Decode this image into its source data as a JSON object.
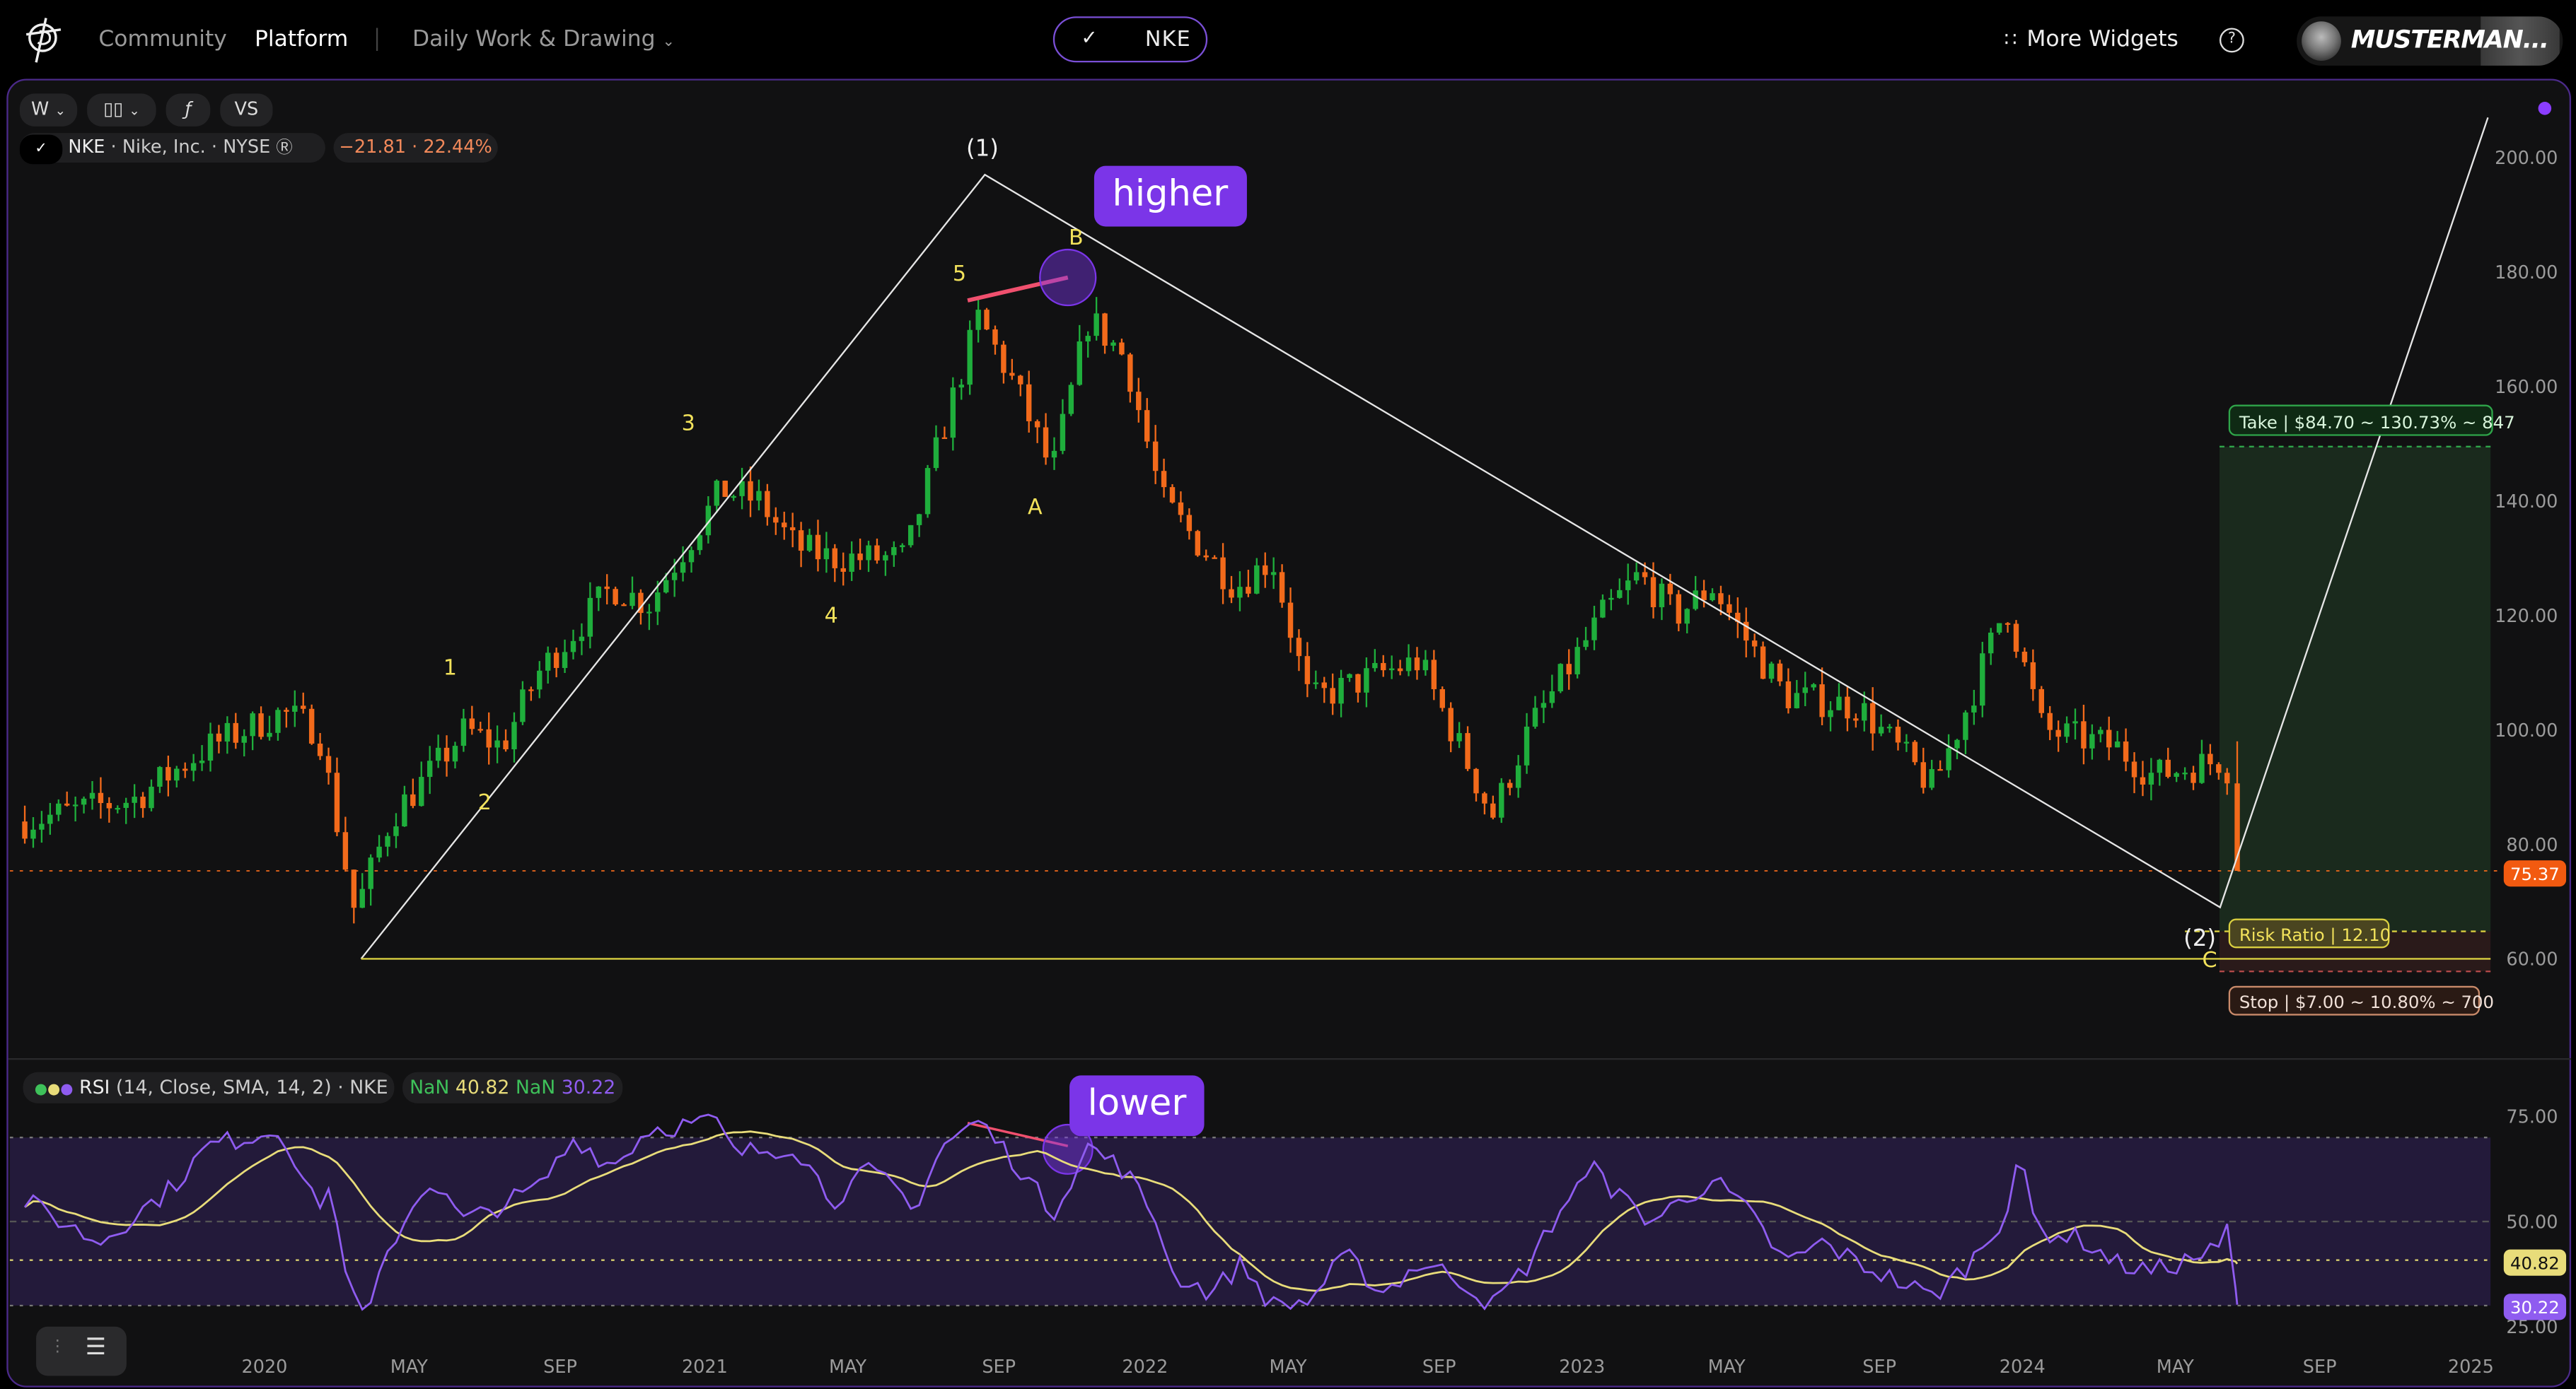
{
  "header": {
    "nav": [
      "Community",
      "Platform"
    ],
    "workspace": "Daily Work & Drawing",
    "ticker": "NKE",
    "more_widgets": "More Widgets",
    "help": "?",
    "user_name": "MUSTERMAN..."
  },
  "toolbar": {
    "interval": "W",
    "chart_type_icon": "candles-icon",
    "indicators_icon": "function-icon",
    "compare": "VS"
  },
  "legend": {
    "symbol": "NKE",
    "name": "Nike, Inc.",
    "exchange": "NYSE",
    "change": "−21.81 · 22.44%"
  },
  "annotations": {
    "higher": "higher",
    "lower": "lower",
    "waves": {
      "w1": "1",
      "w2": "2",
      "w3": "3",
      "w4": "4",
      "w5": "5",
      "wA": "A",
      "wB": "B",
      "wC": "C",
      "p1": "(1)",
      "p2": "(2)"
    },
    "take": "Take | $84.70 ~ 130.73% ~ 847",
    "risk": "Risk Ratio | 12.10",
    "stop": "Stop | $7.00 ~ 10.80% ~ 700"
  },
  "rsi_legend": {
    "title": "RSI",
    "params": "(14, Close, SMA, 14, 2)",
    "symbol": "NKE",
    "v1": "NaN",
    "v2": "40.82",
    "v3": "NaN",
    "v4": "30.22"
  },
  "colors": {
    "up": "#1fae3c",
    "down": "#f26a1b",
    "accent": "#7b35e8",
    "rsi": "#8f5cf0",
    "sma": "#e8dc7a",
    "wave_labels": "#f2e25b"
  },
  "chart_data": [
    {
      "type": "candlestick",
      "symbol": "NKE",
      "interval": "W",
      "last_price": 75.37,
      "ylim": [
        55,
        210
      ],
      "yticks": [
        "200.00",
        "180.00",
        "160.00",
        "140.00",
        "120.00",
        "100.00",
        "80.00",
        "60.00"
      ],
      "xticks": [
        "2020",
        "MAY",
        "SEP",
        "2021",
        "MAY",
        "SEP",
        "2022",
        "MAY",
        "SEP",
        "2023",
        "MAY",
        "SEP",
        "2024",
        "MAY",
        "SEP",
        "2025"
      ],
      "last_price_label": "75.37",
      "approx_close_path": [
        [
          "2019-06",
          84
        ],
        [
          "2019-09",
          88
        ],
        [
          "2019-11",
          97
        ],
        [
          "2020-01",
          103
        ],
        [
          "2020-02",
          100
        ],
        [
          "2020-03",
          68
        ],
        [
          "2020-04",
          85
        ],
        [
          "2020-05",
          92
        ],
        [
          "2020-06",
          100
        ],
        [
          "2020-07",
          97
        ],
        [
          "2020-08",
          110
        ],
        [
          "2020-10",
          125
        ],
        [
          "2020-11",
          122
        ],
        [
          "2021-01",
          142
        ],
        [
          "2021-02",
          140
        ],
        [
          "2021-03",
          132
        ],
        [
          "2021-04",
          130
        ],
        [
          "2021-06",
          130
        ],
        [
          "2021-07",
          152
        ],
        [
          "2021-08",
          172
        ],
        [
          "2021-09",
          160
        ],
        [
          "2021-10",
          145
        ],
        [
          "2021-11",
          172
        ],
        [
          "2021-12",
          165
        ],
        [
          "2022-01",
          140
        ],
        [
          "2022-03",
          125
        ],
        [
          "2022-04",
          130
        ],
        [
          "2022-05",
          105
        ],
        [
          "2022-07",
          110
        ],
        [
          "2022-08",
          112
        ],
        [
          "2022-10",
          85
        ],
        [
          "2022-11",
          100
        ],
        [
          "2023-01",
          120
        ],
        [
          "2023-02",
          127
        ],
        [
          "2023-03",
          120
        ],
        [
          "2023-04",
          125
        ],
        [
          "2023-05",
          115
        ],
        [
          "2023-06",
          106
        ],
        [
          "2023-08",
          104
        ],
        [
          "2023-10",
          90
        ],
        [
          "2023-11",
          105
        ],
        [
          "2023-12",
          122
        ],
        [
          "2024-01",
          100
        ],
        [
          "2024-03",
          97
        ],
        [
          "2024-04",
          92
        ],
        [
          "2024-06",
          95
        ],
        [
          "2024-06-24",
          75.37
        ]
      ],
      "position": {
        "entry": 64.8,
        "take": 149.5,
        "stop": 57.8
      }
    },
    {
      "type": "line",
      "name": "RSI",
      "ylim": [
        20,
        80
      ],
      "yticks": [
        "75.00",
        "50.00",
        "25.00"
      ],
      "levels": [
        70,
        50,
        30
      ],
      "current_labels": [
        "40.82",
        "30.22"
      ],
      "rsi": [
        [
          "2019-06",
          55
        ],
        [
          "2019-08",
          45
        ],
        [
          "2019-10",
          58
        ],
        [
          "2019-11",
          68
        ],
        [
          "2020-01",
          72
        ],
        [
          "2020-02",
          52
        ],
        [
          "2020-02-20",
          62
        ],
        [
          "2020-03",
          30
        ],
        [
          "2020-03-25",
          27
        ],
        [
          "2020-04",
          45
        ],
        [
          "2020-05",
          60
        ],
        [
          "2020-06",
          50
        ],
        [
          "2020-08",
          58
        ],
        [
          "2020-09",
          70
        ],
        [
          "2020-10",
          63
        ],
        [
          "2020-11",
          72
        ],
        [
          "2021-01",
          74
        ],
        [
          "2021-01-20",
          66
        ],
        [
          "2021-03",
          68
        ],
        [
          "2021-04",
          55
        ],
        [
          "2021-05",
          62
        ],
        [
          "2021-06",
          56
        ],
        [
          "2021-06-20",
          52
        ],
        [
          "2021-07",
          68
        ],
        [
          "2021-08",
          74
        ],
        [
          "2021-09",
          64
        ],
        [
          "2021-10",
          52
        ],
        [
          "2021-11",
          68
        ],
        [
          "2021-12",
          62
        ],
        [
          "2022-01",
          48
        ],
        [
          "2022-01-20",
          38
        ],
        [
          "2022-02-25",
          33
        ],
        [
          "2022-03-20",
          40
        ],
        [
          "2022-04-15",
          30
        ],
        [
          "2022-05",
          31
        ],
        [
          "2022-06",
          42
        ],
        [
          "2022-07",
          33
        ],
        [
          "2022-08",
          40
        ],
        [
          "2022-09",
          37
        ],
        [
          "2022-10",
          30
        ],
        [
          "2022-11",
          40
        ],
        [
          "2022-12",
          55
        ],
        [
          "2023-01",
          64
        ],
        [
          "2023-01-20",
          58
        ],
        [
          "2023-02-25",
          50
        ],
        [
          "2023-04",
          60
        ],
        [
          "2023-05",
          52
        ],
        [
          "2023-06",
          40
        ],
        [
          "2023-07",
          45
        ],
        [
          "2023-08",
          40
        ],
        [
          "2023-09",
          36
        ],
        [
          "2023-10",
          32
        ],
        [
          "2023-11",
          40
        ],
        [
          "2023-12",
          52
        ],
        [
          "2023-12-25",
          66
        ],
        [
          "2024-01-10",
          48
        ],
        [
          "2024-02",
          46
        ],
        [
          "2024-03",
          40
        ],
        [
          "2024-04",
          38
        ],
        [
          "2024-06",
          44
        ],
        [
          "2024-06-15",
          50
        ],
        [
          "2024-06-24",
          30.22
        ]
      ],
      "sma_last": 40.82
    }
  ]
}
